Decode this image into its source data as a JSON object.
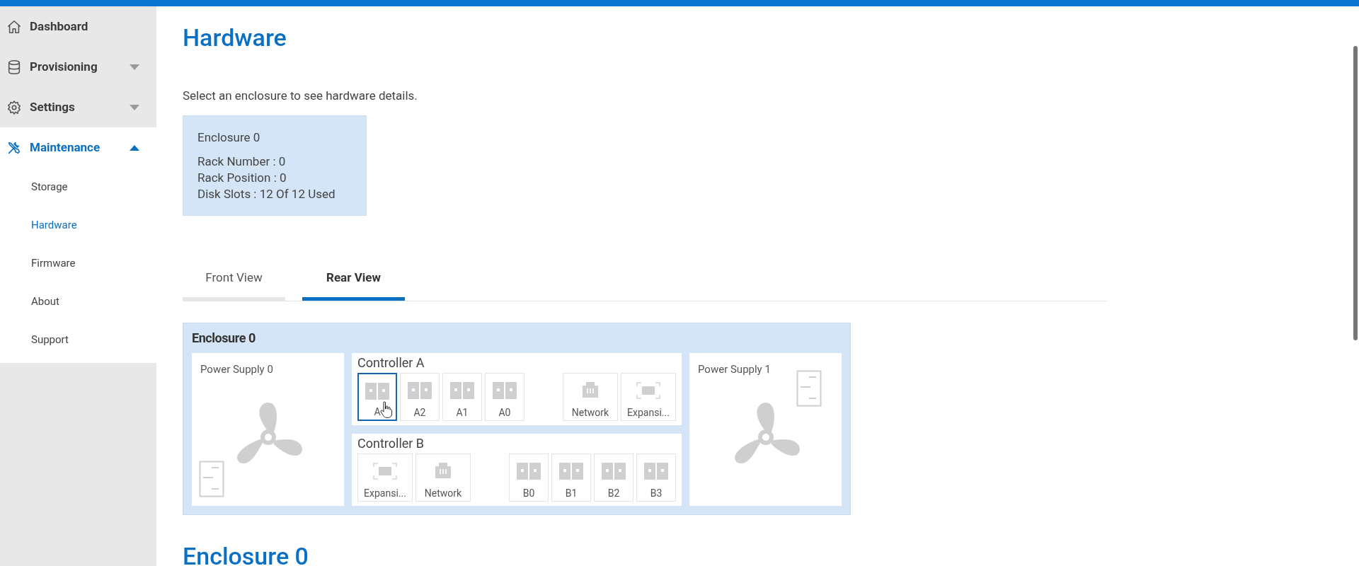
{
  "sidebar": {
    "items": [
      {
        "label": "Dashboard",
        "expanded": false,
        "has_caret": false
      },
      {
        "label": "Provisioning",
        "expanded": false,
        "has_caret": true
      },
      {
        "label": "Settings",
        "expanded": false,
        "has_caret": true
      },
      {
        "label": "Maintenance",
        "expanded": true,
        "has_caret": true,
        "children": [
          {
            "label": "Storage",
            "selected": false
          },
          {
            "label": "Hardware",
            "selected": true
          },
          {
            "label": "Firmware",
            "selected": false
          },
          {
            "label": "About",
            "selected": false
          },
          {
            "label": "Support",
            "selected": false
          }
        ]
      }
    ]
  },
  "page": {
    "title": "Hardware",
    "description": "Select an enclosure to see hardware details."
  },
  "enclosure_cards": [
    {
      "title": "Enclosure 0",
      "lines": [
        "Rack Number : 0",
        "Rack Position : 0",
        "Disk Slots : 12 Of 12 Used"
      ],
      "selected": true
    }
  ],
  "tabs": [
    {
      "label": "Front View",
      "selected": false
    },
    {
      "label": "Rear View",
      "selected": true
    }
  ],
  "rear_view": {
    "title": "Enclosure 0",
    "power_supplies": [
      {
        "label": "Power Supply 0"
      },
      {
        "label": "Power Supply 1"
      }
    ],
    "controllers": [
      {
        "label": "Controller A",
        "ports": [
          {
            "kind": "sas",
            "label": "A",
            "selected": true
          },
          {
            "kind": "sas",
            "label": "A2",
            "selected": false
          },
          {
            "kind": "sas",
            "label": "A1",
            "selected": false
          },
          {
            "kind": "sas",
            "label": "A0",
            "selected": false
          },
          {
            "kind": "gap"
          },
          {
            "kind": "network",
            "label": "Network",
            "selected": false
          },
          {
            "kind": "expansion",
            "label": "Expansi...",
            "selected": false
          }
        ]
      },
      {
        "label": "Controller B",
        "ports": [
          {
            "kind": "expansion",
            "label": "Expansi...",
            "selected": false
          },
          {
            "kind": "network",
            "label": "Network",
            "selected": false
          },
          {
            "kind": "gap"
          },
          {
            "kind": "sas",
            "label": "B0",
            "selected": false
          },
          {
            "kind": "sas",
            "label": "B1",
            "selected": false
          },
          {
            "kind": "sas",
            "label": "B2",
            "selected": false
          },
          {
            "kind": "sas",
            "label": "B3",
            "selected": false
          }
        ]
      }
    ]
  },
  "next_section": {
    "title": "Enclosure 0"
  }
}
